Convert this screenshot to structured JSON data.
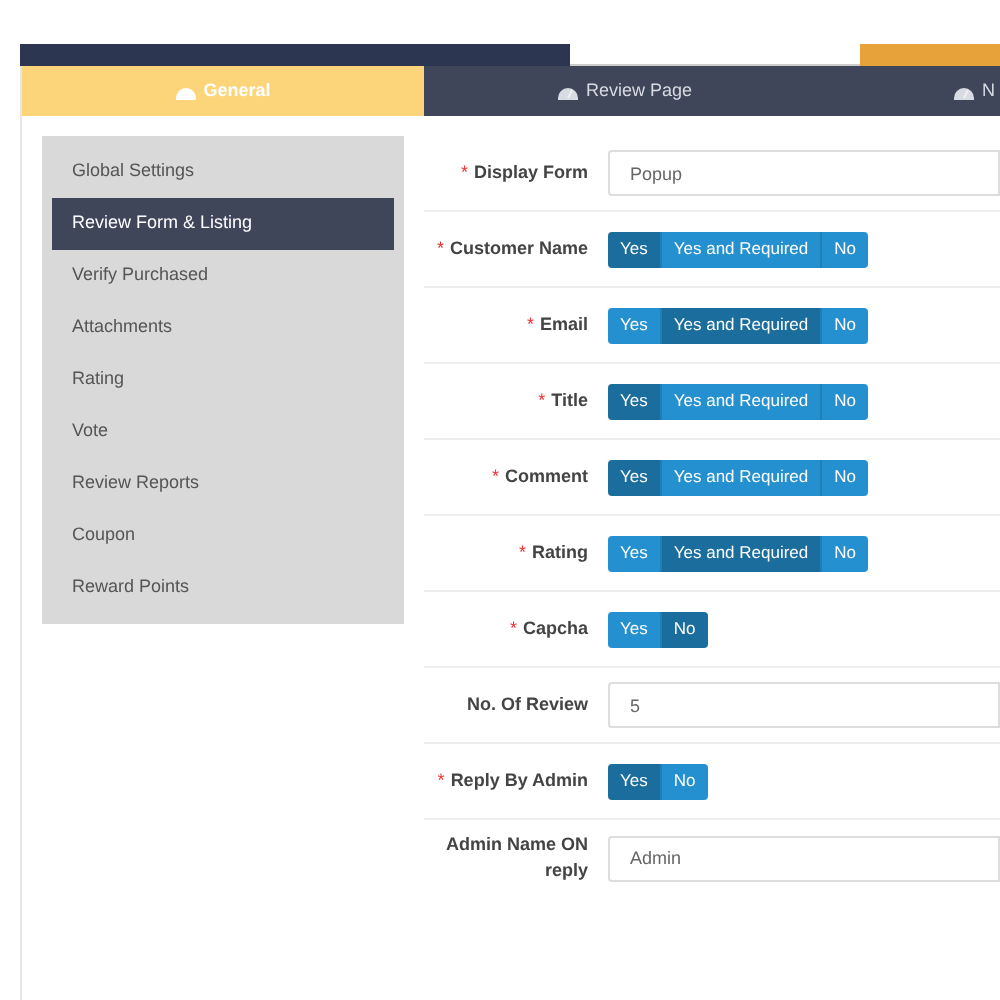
{
  "tabs": [
    {
      "label": "General",
      "selected": true
    },
    {
      "label": "Review Page",
      "selected": false
    },
    {
      "label": "N",
      "selected": false
    }
  ],
  "sidebar": {
    "items": [
      {
        "label": "Global Settings",
        "selected": false
      },
      {
        "label": "Review Form & Listing",
        "selected": true
      },
      {
        "label": "Verify Purchased",
        "selected": false
      },
      {
        "label": "Attachments",
        "selected": false
      },
      {
        "label": "Rating",
        "selected": false
      },
      {
        "label": "Vote",
        "selected": false
      },
      {
        "label": "Review Reports",
        "selected": false
      },
      {
        "label": "Coupon",
        "selected": false
      },
      {
        "label": "Reward Points",
        "selected": false
      }
    ]
  },
  "form": [
    {
      "kind": "field",
      "label": "Display Form",
      "required_mark": "*",
      "value": "Popup"
    },
    {
      "kind": "toggle",
      "label": "Customer Name",
      "required_mark": "*",
      "options": [
        {
          "label": "Yes",
          "selected": true
        },
        {
          "label": "Yes and Required",
          "selected": false
        },
        {
          "label": "No",
          "selected": false
        }
      ]
    },
    {
      "kind": "toggle",
      "label": "Email",
      "required_mark": "*",
      "options": [
        {
          "label": "Yes",
          "selected": false
        },
        {
          "label": "Yes and Required",
          "selected": true
        },
        {
          "label": "No",
          "selected": false
        }
      ]
    },
    {
      "kind": "toggle",
      "label": "Title",
      "required_mark": "*",
      "options": [
        {
          "label": "Yes",
          "selected": true
        },
        {
          "label": "Yes and Required",
          "selected": false
        },
        {
          "label": "No",
          "selected": false
        }
      ]
    },
    {
      "kind": "toggle",
      "label": "Comment",
      "required_mark": "*",
      "options": [
        {
          "label": "Yes",
          "selected": true
        },
        {
          "label": "Yes and Required",
          "selected": false
        },
        {
          "label": "No",
          "selected": false
        }
      ]
    },
    {
      "kind": "toggle",
      "label": "Rating",
      "required_mark": "*",
      "options": [
        {
          "label": "Yes",
          "selected": false
        },
        {
          "label": "Yes and Required",
          "selected": true
        },
        {
          "label": "No",
          "selected": false
        }
      ]
    },
    {
      "kind": "toggle",
      "label": "Capcha",
      "required_mark": "*",
      "options": [
        {
          "label": "Yes",
          "selected": false
        },
        {
          "label": "No",
          "selected": true
        }
      ]
    },
    {
      "kind": "field",
      "label": "No. Of Review",
      "value": "5"
    },
    {
      "kind": "toggle",
      "label": "Reply By Admin",
      "required_mark": "*",
      "options": [
        {
          "label": "Yes",
          "selected": true
        },
        {
          "label": "No",
          "selected": false
        }
      ]
    },
    {
      "kind": "field",
      "label": "Admin Name ON reply",
      "value": "Admin"
    }
  ]
}
